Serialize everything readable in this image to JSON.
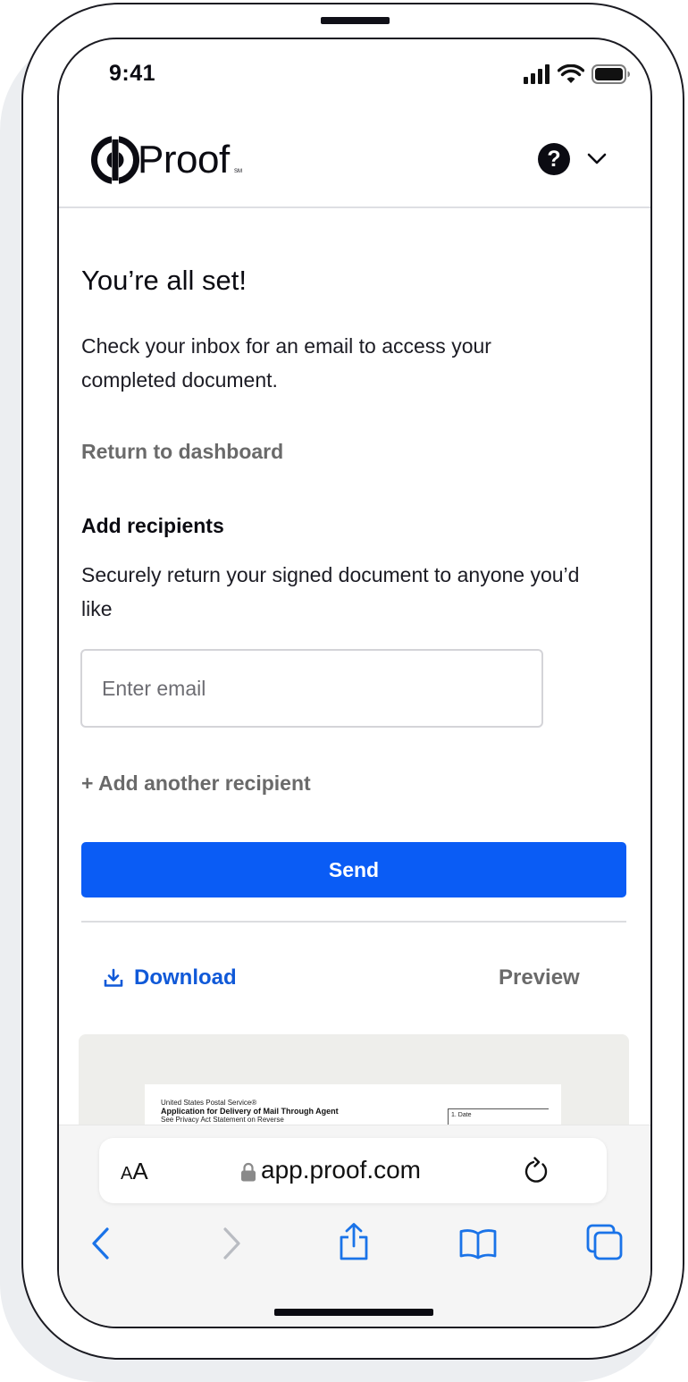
{
  "status_bar": {
    "time": "9:41"
  },
  "header": {
    "brand": "Proof",
    "brand_mark": "SM",
    "help_symbol": "?"
  },
  "main": {
    "title": "You’re all set!",
    "message": "Check your inbox for an email to access your completed document.",
    "return_link": "Return to dashboard",
    "recipients": {
      "heading": "Add recipients",
      "description": "Securely return your signed document to anyone you’d like",
      "email_placeholder": "Enter email",
      "add_another": "+ Add another recipient",
      "send_label": "Send"
    },
    "actions": {
      "download_label": "Download",
      "preview_label": "Preview"
    },
    "preview_doc": {
      "agency": "United States Postal Service®",
      "title": "Application for Delivery of Mail Through Agent",
      "subtitle": "See Privacy Act Statement on Reverse",
      "field_date": "1. Date"
    }
  },
  "browser": {
    "text_size_small": "A",
    "text_size_large": "A",
    "url": "app.proof.com"
  },
  "colors": {
    "accent": "#0a5cf5",
    "link_blue": "#1059d8",
    "muted": "#6a6a6a",
    "ink": "#0b0b12"
  },
  "icons": [
    "signal-icon",
    "wifi-icon",
    "battery-icon",
    "proof-logo-icon",
    "help-icon",
    "chevron-down-icon",
    "download-icon",
    "lock-icon",
    "reload-icon",
    "back-arrow-icon",
    "forward-arrow-icon",
    "share-icon",
    "bookmarks-icon",
    "tabs-icon"
  ]
}
